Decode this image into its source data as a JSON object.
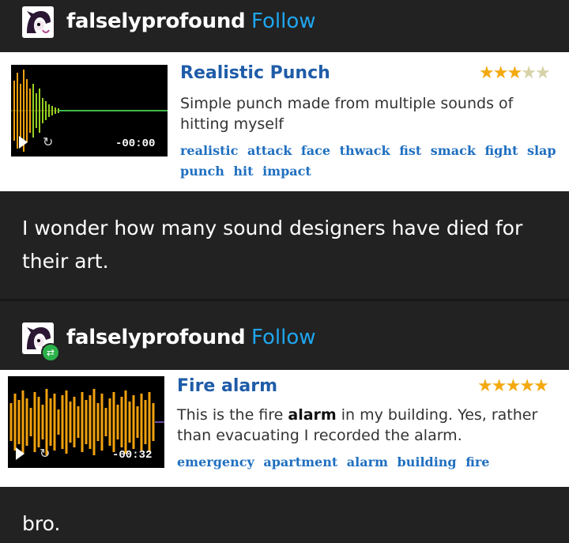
{
  "posts": [
    {
      "username": "falselyprofound",
      "follow_label": "Follow",
      "sound": {
        "title": "Realistic Punch",
        "rating": 3,
        "max_rating": 5,
        "time": "-00:00",
        "description": "Simple punch made from multiple sounds of hitting myself",
        "tags": [
          "realistic",
          "attack",
          "face",
          "thwack",
          "fist",
          "smack",
          "fight",
          "slap",
          "punch",
          "hit",
          "impact"
        ]
      },
      "caption": "I wonder how many sound designers have died for their art."
    },
    {
      "username": "falselyprofound",
      "follow_label": "Follow",
      "sound": {
        "title": "Fire alarm",
        "rating": 5,
        "max_rating": 5,
        "time": "-00:32",
        "description_before": "This is the fire ",
        "description_bold": "alarm",
        "description_after": " in my building. Yes, rather than evacuating I recorded the alarm.",
        "tags": [
          "emergency",
          "apartment",
          "alarm",
          "building",
          "fire"
        ]
      },
      "caption": "bro."
    }
  ],
  "icons": {
    "play": "play-icon",
    "loop": "loop-icon",
    "reblog": "reblog-icon",
    "star": "star-icon"
  },
  "colors": {
    "follow": "#1fa6f0",
    "title": "#1f5ca8",
    "tag": "#1f6fc0",
    "star": "#f3a90f",
    "reblog": "#2bb14a"
  }
}
